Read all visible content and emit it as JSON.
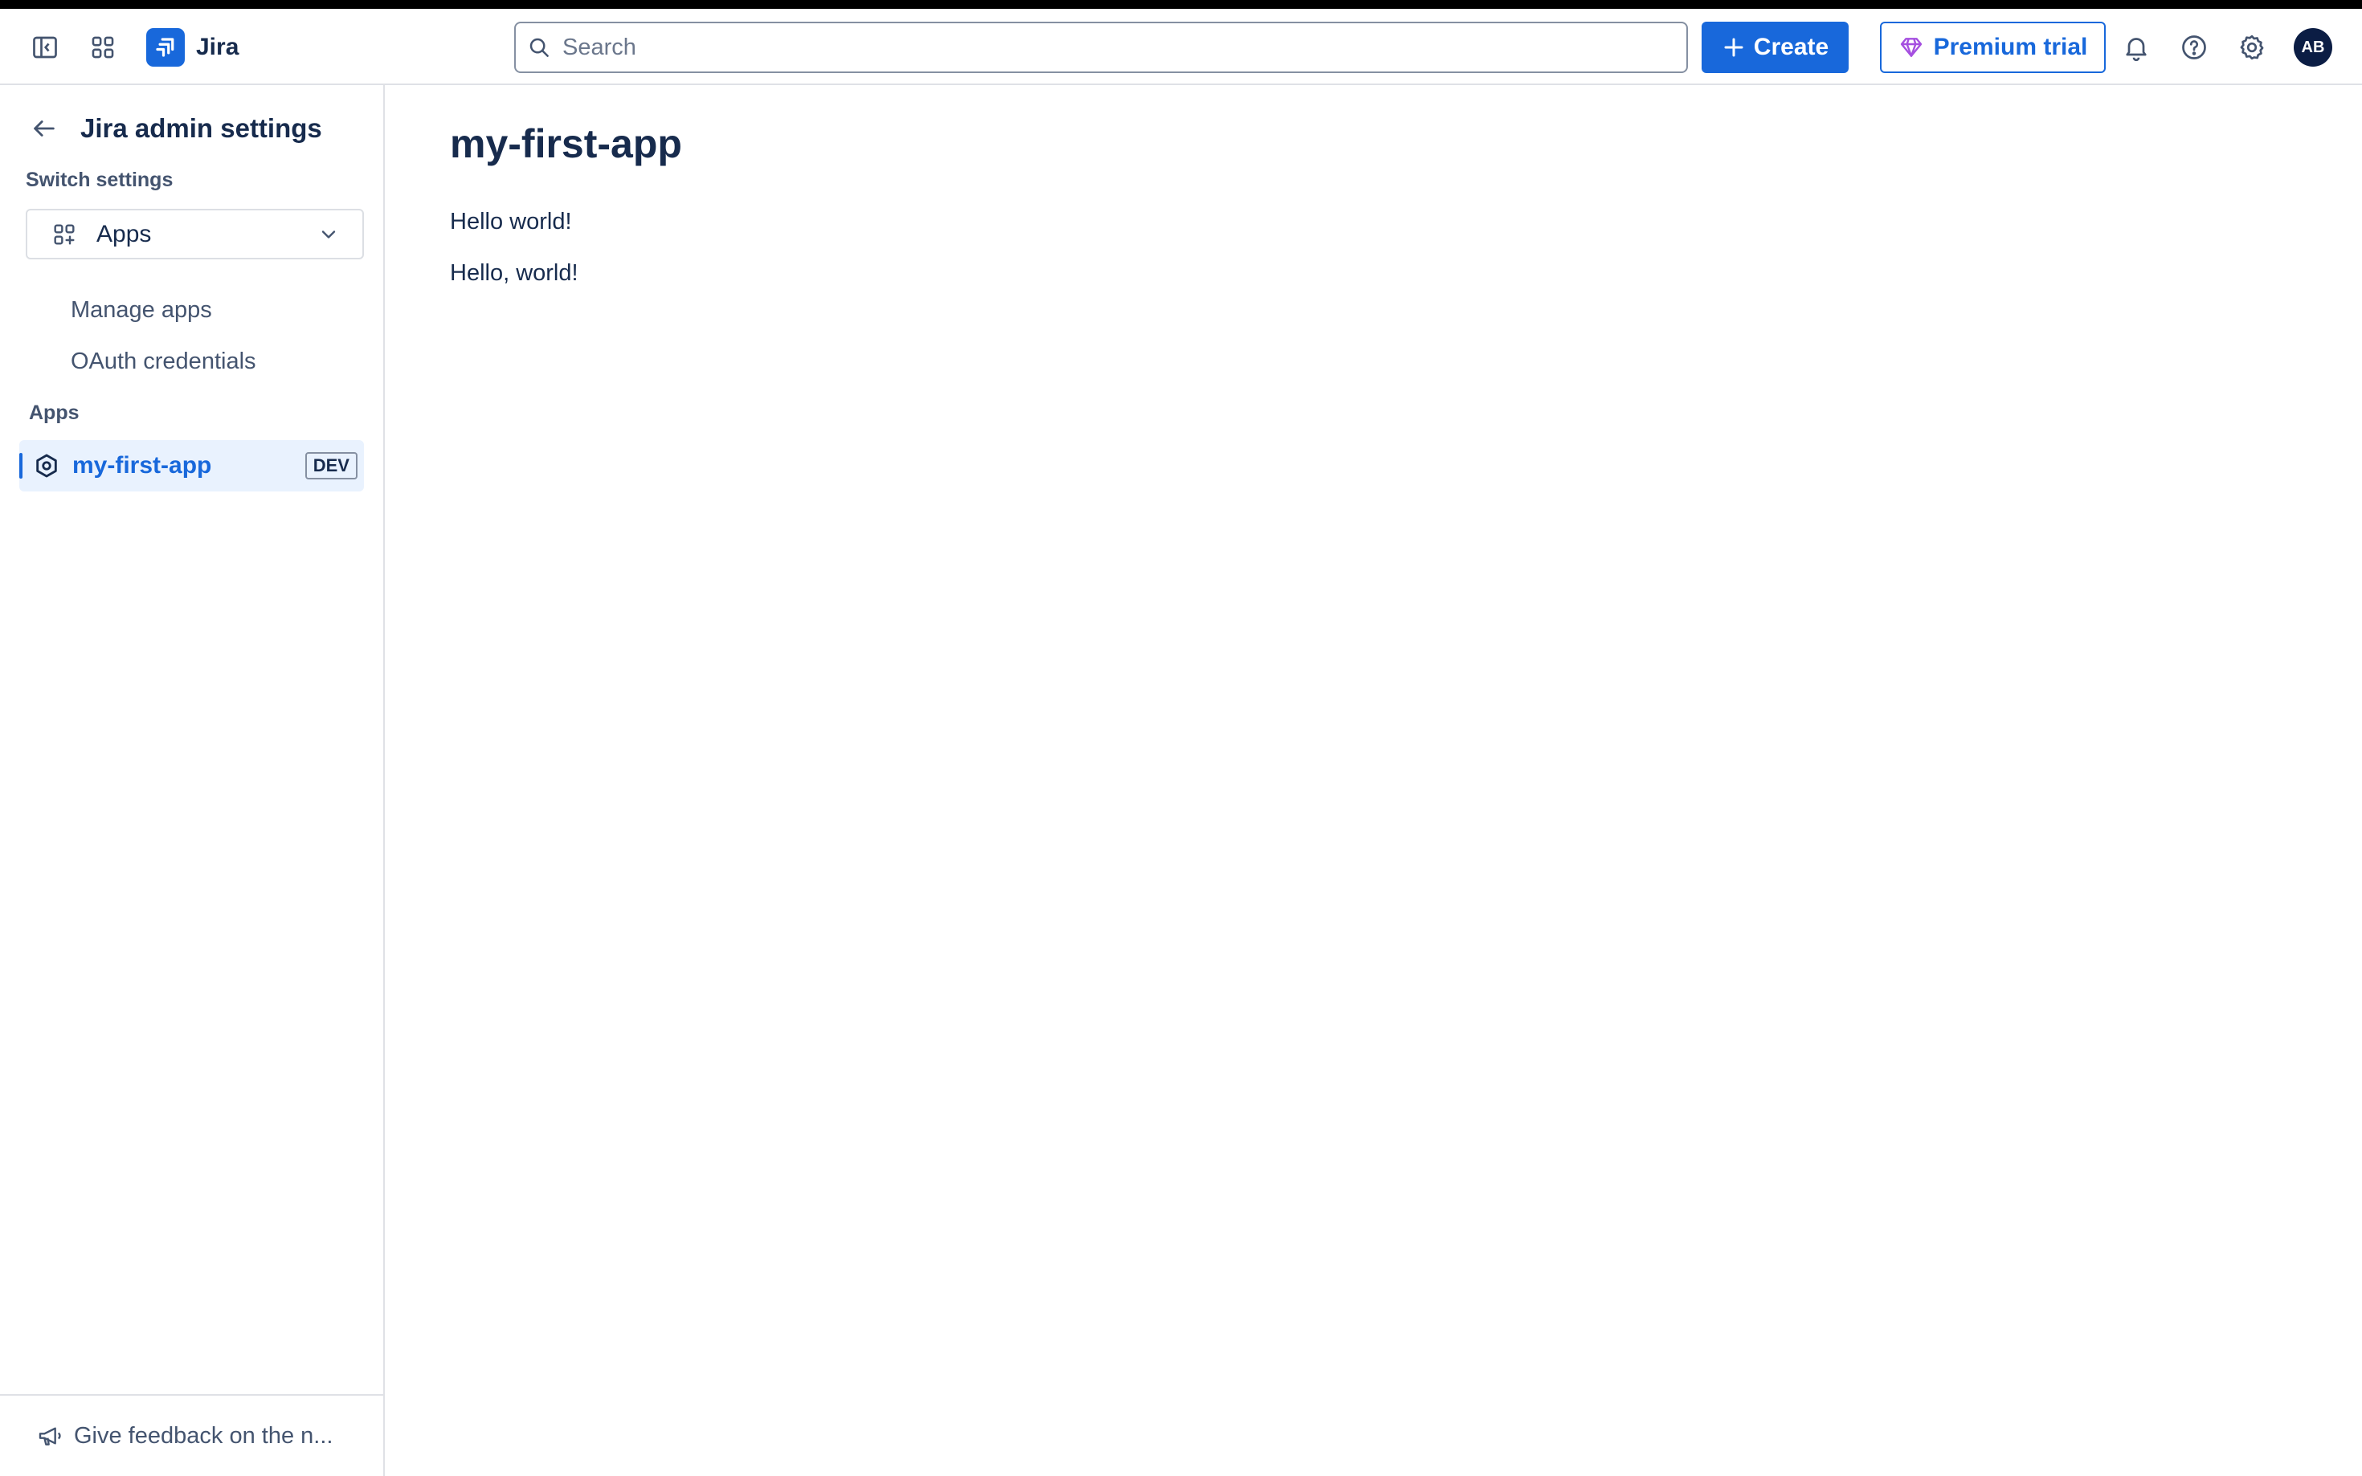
{
  "topnav": {
    "logo_text": "Jira",
    "search_placeholder": "Search",
    "create_label": "Create",
    "premium_label": "Premium trial",
    "avatar_initials": "AB",
    "icons": {
      "sidebar_toggle": "sidebar-toggle-icon",
      "app_switcher": "app-switcher-icon",
      "notifications": "bell-icon",
      "help": "help-icon",
      "settings": "gear-icon"
    }
  },
  "sidebar": {
    "title": "Jira admin settings",
    "switch_label": "Switch settings",
    "switch_value": "Apps",
    "links": [
      {
        "label": "Manage apps"
      },
      {
        "label": "OAuth credentials"
      }
    ],
    "apps_label": "Apps",
    "apps": [
      {
        "label": "my-first-app",
        "badge": "DEV",
        "selected": true
      }
    ],
    "footer_label": "Give feedback on the n..."
  },
  "main": {
    "title": "my-first-app",
    "lines": [
      "Hello world!",
      "Hello, world!"
    ]
  },
  "colors": {
    "brand_blue": "#1868db",
    "text_primary": "#172b4d",
    "text_subtle": "#44546f",
    "selected_bg": "#e9f2fe",
    "border": "#dfe1e6",
    "avatar_bg": "#0b1d44"
  }
}
